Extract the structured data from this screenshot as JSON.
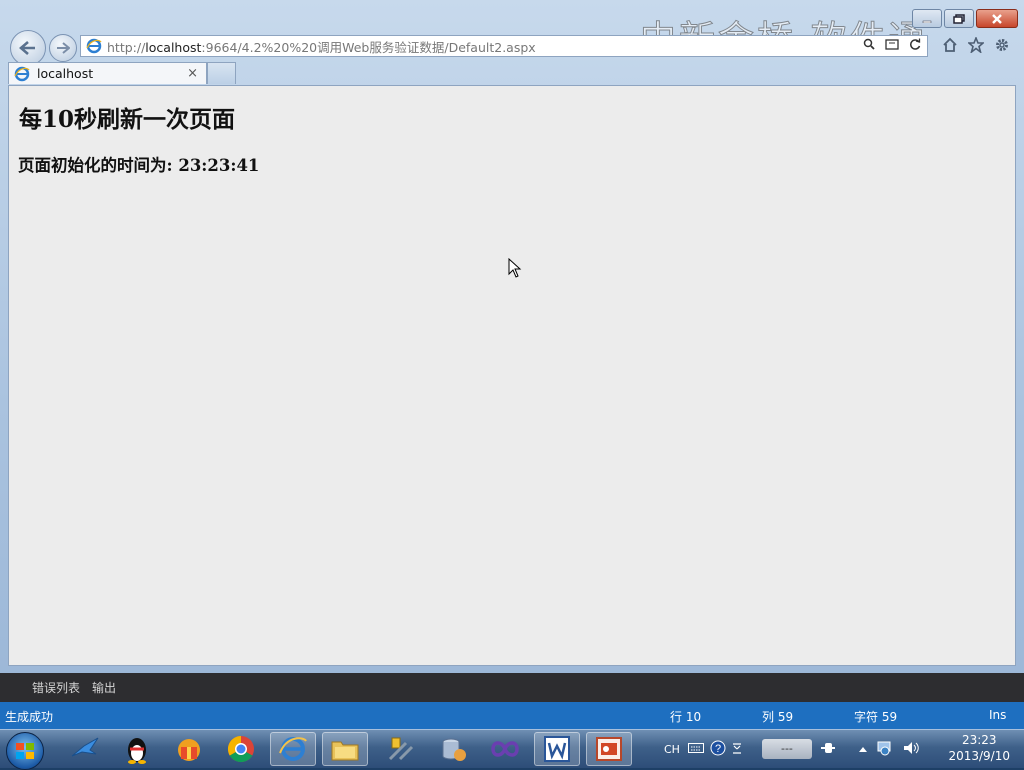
{
  "browser": {
    "url_prefix": "http://",
    "url_host": "localhost",
    "url_rest": ":9664/4.2%20%20调用Web服务验证数据/Default2.aspx",
    "tab_title": "localhost",
    "tab_close": "×",
    "watermark": "中新金桥  软件通"
  },
  "page": {
    "heading": "每10秒刷新一次页面",
    "time_label": "页面初始化的时间为: 23:23:41"
  },
  "vs": {
    "tabs": [
      "错误列表",
      "输出"
    ],
    "status": {
      "message": "生成成功",
      "line": "行 10",
      "col": "列 59",
      "char": "字符 59",
      "mode": "Ins"
    }
  },
  "taskbar": {
    "lang": "CH",
    "indicator": "---",
    "time": "23:23",
    "date": "2013/9/10"
  },
  "colors": {
    "status_bar": "#1e6fc0",
    "vs_panel": "#2d2d30",
    "page_bg": "#ececec"
  }
}
